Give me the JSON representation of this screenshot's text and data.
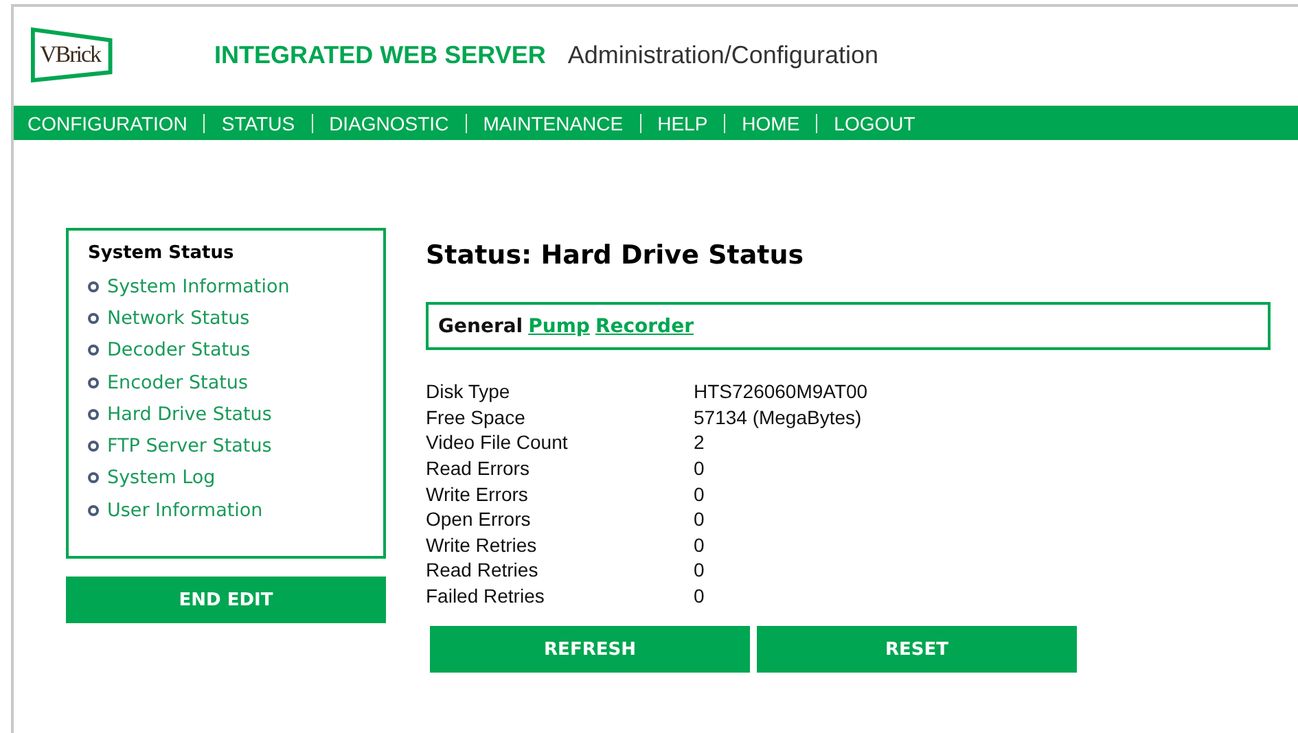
{
  "header": {
    "logo": "VBrick",
    "title": "INTEGRATED WEB SERVER",
    "subtitle": "Administration/Configuration"
  },
  "nav": [
    "CONFIGURATION",
    "STATUS",
    "DIAGNOSTIC",
    "MAINTENANCE",
    "HELP",
    "HOME",
    "LOGOUT"
  ],
  "sidebar": {
    "title": "System Status",
    "items": [
      "System Information",
      "Network Status",
      "Decoder Status",
      "Encoder Status",
      "Hard Drive Status",
      "FTP Server Status",
      "System Log",
      "User Information"
    ],
    "button": "END EDIT"
  },
  "page_title": "Status: Hard Drive Status",
  "tabs": [
    {
      "label": "General",
      "selected": true
    },
    {
      "label": "Pump",
      "selected": false
    },
    {
      "label": "Recorder",
      "selected": false
    }
  ],
  "rows": [
    {
      "label": "Disk Type",
      "value": "HTS726060M9AT00"
    },
    {
      "label": "Free Space",
      "value": "57134 (MegaBytes)"
    },
    {
      "label": "Video File Count",
      "value": "2"
    },
    {
      "label": "Read Errors",
      "value": "0"
    },
    {
      "label": "Write Errors",
      "value": "0"
    },
    {
      "label": "Open Errors",
      "value": "0"
    },
    {
      "label": "Write Retries",
      "value": "0"
    },
    {
      "label": "Read Retries",
      "value": "0"
    },
    {
      "label": "Failed Retries",
      "value": "0"
    }
  ],
  "buttons": [
    "REFRESH",
    "RESET"
  ]
}
